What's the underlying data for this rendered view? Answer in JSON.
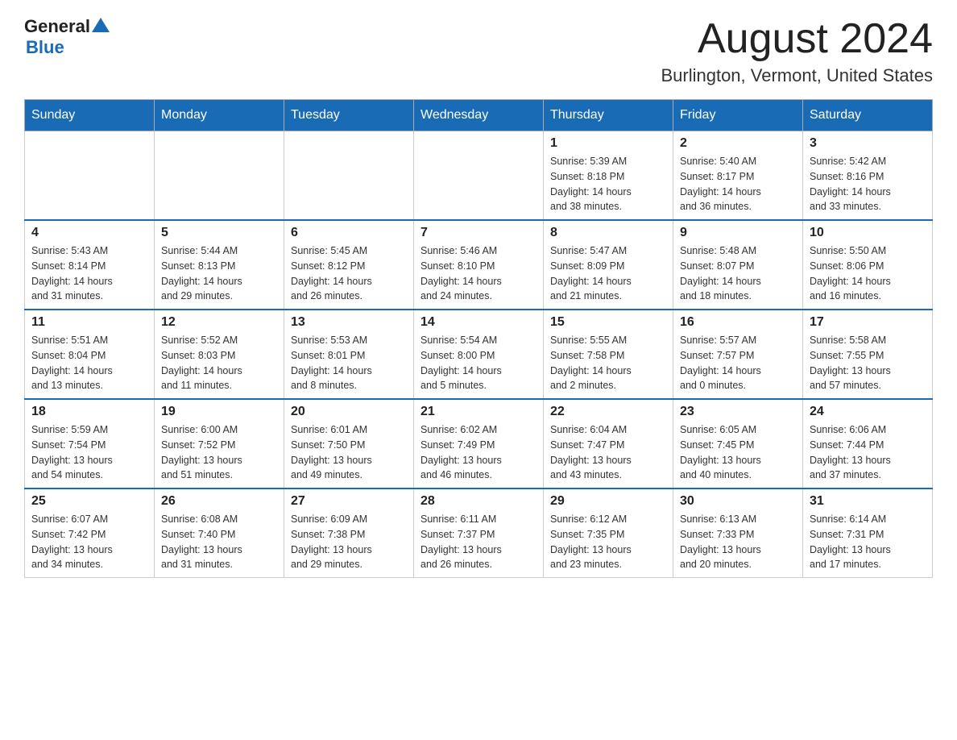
{
  "header": {
    "logo_general": "General",
    "logo_blue": "Blue",
    "month": "August 2024",
    "location": "Burlington, Vermont, United States"
  },
  "days_of_week": [
    "Sunday",
    "Monday",
    "Tuesday",
    "Wednesday",
    "Thursday",
    "Friday",
    "Saturday"
  ],
  "weeks": [
    [
      {
        "day": "",
        "info": ""
      },
      {
        "day": "",
        "info": ""
      },
      {
        "day": "",
        "info": ""
      },
      {
        "day": "",
        "info": ""
      },
      {
        "day": "1",
        "info": "Sunrise: 5:39 AM\nSunset: 8:18 PM\nDaylight: 14 hours\nand 38 minutes."
      },
      {
        "day": "2",
        "info": "Sunrise: 5:40 AM\nSunset: 8:17 PM\nDaylight: 14 hours\nand 36 minutes."
      },
      {
        "day": "3",
        "info": "Sunrise: 5:42 AM\nSunset: 8:16 PM\nDaylight: 14 hours\nand 33 minutes."
      }
    ],
    [
      {
        "day": "4",
        "info": "Sunrise: 5:43 AM\nSunset: 8:14 PM\nDaylight: 14 hours\nand 31 minutes."
      },
      {
        "day": "5",
        "info": "Sunrise: 5:44 AM\nSunset: 8:13 PM\nDaylight: 14 hours\nand 29 minutes."
      },
      {
        "day": "6",
        "info": "Sunrise: 5:45 AM\nSunset: 8:12 PM\nDaylight: 14 hours\nand 26 minutes."
      },
      {
        "day": "7",
        "info": "Sunrise: 5:46 AM\nSunset: 8:10 PM\nDaylight: 14 hours\nand 24 minutes."
      },
      {
        "day": "8",
        "info": "Sunrise: 5:47 AM\nSunset: 8:09 PM\nDaylight: 14 hours\nand 21 minutes."
      },
      {
        "day": "9",
        "info": "Sunrise: 5:48 AM\nSunset: 8:07 PM\nDaylight: 14 hours\nand 18 minutes."
      },
      {
        "day": "10",
        "info": "Sunrise: 5:50 AM\nSunset: 8:06 PM\nDaylight: 14 hours\nand 16 minutes."
      }
    ],
    [
      {
        "day": "11",
        "info": "Sunrise: 5:51 AM\nSunset: 8:04 PM\nDaylight: 14 hours\nand 13 minutes."
      },
      {
        "day": "12",
        "info": "Sunrise: 5:52 AM\nSunset: 8:03 PM\nDaylight: 14 hours\nand 11 minutes."
      },
      {
        "day": "13",
        "info": "Sunrise: 5:53 AM\nSunset: 8:01 PM\nDaylight: 14 hours\nand 8 minutes."
      },
      {
        "day": "14",
        "info": "Sunrise: 5:54 AM\nSunset: 8:00 PM\nDaylight: 14 hours\nand 5 minutes."
      },
      {
        "day": "15",
        "info": "Sunrise: 5:55 AM\nSunset: 7:58 PM\nDaylight: 14 hours\nand 2 minutes."
      },
      {
        "day": "16",
        "info": "Sunrise: 5:57 AM\nSunset: 7:57 PM\nDaylight: 14 hours\nand 0 minutes."
      },
      {
        "day": "17",
        "info": "Sunrise: 5:58 AM\nSunset: 7:55 PM\nDaylight: 13 hours\nand 57 minutes."
      }
    ],
    [
      {
        "day": "18",
        "info": "Sunrise: 5:59 AM\nSunset: 7:54 PM\nDaylight: 13 hours\nand 54 minutes."
      },
      {
        "day": "19",
        "info": "Sunrise: 6:00 AM\nSunset: 7:52 PM\nDaylight: 13 hours\nand 51 minutes."
      },
      {
        "day": "20",
        "info": "Sunrise: 6:01 AM\nSunset: 7:50 PM\nDaylight: 13 hours\nand 49 minutes."
      },
      {
        "day": "21",
        "info": "Sunrise: 6:02 AM\nSunset: 7:49 PM\nDaylight: 13 hours\nand 46 minutes."
      },
      {
        "day": "22",
        "info": "Sunrise: 6:04 AM\nSunset: 7:47 PM\nDaylight: 13 hours\nand 43 minutes."
      },
      {
        "day": "23",
        "info": "Sunrise: 6:05 AM\nSunset: 7:45 PM\nDaylight: 13 hours\nand 40 minutes."
      },
      {
        "day": "24",
        "info": "Sunrise: 6:06 AM\nSunset: 7:44 PM\nDaylight: 13 hours\nand 37 minutes."
      }
    ],
    [
      {
        "day": "25",
        "info": "Sunrise: 6:07 AM\nSunset: 7:42 PM\nDaylight: 13 hours\nand 34 minutes."
      },
      {
        "day": "26",
        "info": "Sunrise: 6:08 AM\nSunset: 7:40 PM\nDaylight: 13 hours\nand 31 minutes."
      },
      {
        "day": "27",
        "info": "Sunrise: 6:09 AM\nSunset: 7:38 PM\nDaylight: 13 hours\nand 29 minutes."
      },
      {
        "day": "28",
        "info": "Sunrise: 6:11 AM\nSunset: 7:37 PM\nDaylight: 13 hours\nand 26 minutes."
      },
      {
        "day": "29",
        "info": "Sunrise: 6:12 AM\nSunset: 7:35 PM\nDaylight: 13 hours\nand 23 minutes."
      },
      {
        "day": "30",
        "info": "Sunrise: 6:13 AM\nSunset: 7:33 PM\nDaylight: 13 hours\nand 20 minutes."
      },
      {
        "day": "31",
        "info": "Sunrise: 6:14 AM\nSunset: 7:31 PM\nDaylight: 13 hours\nand 17 minutes."
      }
    ]
  ]
}
